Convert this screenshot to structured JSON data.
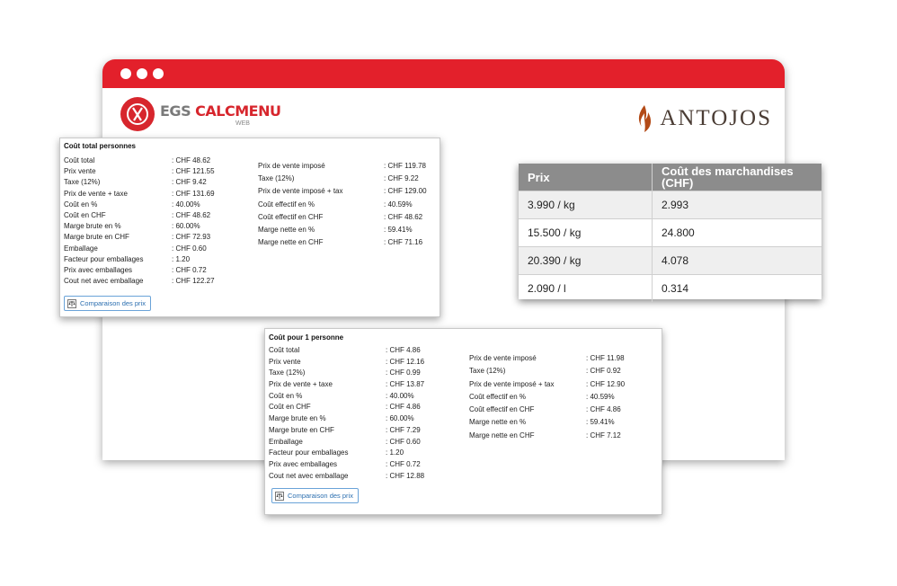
{
  "brands": {
    "left_logo": {
      "part1": "EGS",
      "part2": "CALCMENU",
      "sub": "WEB"
    },
    "right_logo": "ANTOJOS"
  },
  "colors": {
    "browser_bar": "#e3202b",
    "logo_red": "#d7262d",
    "table_header": "#8c8c8c",
    "button_blue": "#2c6fb0"
  },
  "total_panel": {
    "title": "Coût total personnes",
    "left": [
      {
        "label": "Coût total",
        "value": ": CHF 48.62"
      },
      {
        "label": "Prix vente",
        "value": ": CHF 121.55"
      },
      {
        "label": "Taxe (12%)",
        "value": ": CHF 9.42"
      },
      {
        "label": "Prix de vente + taxe",
        "value": ": CHF 131.69"
      },
      {
        "label": "Coût en %",
        "value": ": 40.00%"
      },
      {
        "label": "Coût en CHF",
        "value": ": CHF 48.62"
      },
      {
        "label": "Marge brute en %",
        "value": ": 60.00%"
      },
      {
        "label": "Marge brute en CHF",
        "value": ": CHF 72.93"
      },
      {
        "label": "Emballage",
        "value": ": CHF 0.60"
      },
      {
        "label": "Facteur pour emballages",
        "value": ": 1.20"
      },
      {
        "label": "Prix avec emballages",
        "value": ": CHF 0.72"
      },
      {
        "label": "Cout net avec emballage",
        "value": ": CHF 122.27"
      }
    ],
    "right": [
      {
        "label": "Prix de vente imposé",
        "value": ": CHF 119.78"
      },
      {
        "label": "Taxe (12%)",
        "value": ": CHF 9.22"
      },
      {
        "label": "Prix de vente imposé + tax",
        "value": ": CHF 129.00"
      },
      {
        "label": "Coût effectif en %",
        "value": ": 40.59%"
      },
      {
        "label": "Coût effectif en CHF",
        "value": ": CHF 48.62"
      },
      {
        "label": "Marge nette en %",
        "value": ": 59.41%"
      },
      {
        "label": "Marge nette en CHF",
        "value": ": CHF 71.16"
      }
    ],
    "button": "Comparaison des prix"
  },
  "person_panel": {
    "title": "Coût pour 1 personne",
    "left": [
      {
        "label": "Coût total",
        "value": ": CHF 4.86"
      },
      {
        "label": "Prix vente",
        "value": ": CHF 12.16"
      },
      {
        "label": "Taxe (12%)",
        "value": ": CHF 0.99"
      },
      {
        "label": "Prix de vente + taxe",
        "value": ": CHF 13.87"
      },
      {
        "label": "Coût en %",
        "value": ": 40.00%"
      },
      {
        "label": "Coût en CHF",
        "value": ": CHF 4.86"
      },
      {
        "label": "Marge brute en %",
        "value": ": 60.00%"
      },
      {
        "label": "Marge brute en CHF",
        "value": ": CHF 7.29"
      },
      {
        "label": "Emballage",
        "value": ": CHF 0.60"
      },
      {
        "label": "Facteur pour emballages",
        "value": ": 1.20"
      },
      {
        "label": "Prix avec emballages",
        "value": ": CHF 0.72"
      },
      {
        "label": "Cout net avec emballage",
        "value": ": CHF 12.88"
      }
    ],
    "right": [
      {
        "label": "Prix de vente imposé",
        "value": ": CHF 11.98"
      },
      {
        "label": "Taxe (12%)",
        "value": ": CHF 0.92"
      },
      {
        "label": "Prix de vente imposé + tax",
        "value": ": CHF 12.90"
      },
      {
        "label": "Coût effectif en %",
        "value": ": 40.59%"
      },
      {
        "label": "Coût effectif en CHF",
        "value": ": CHF 4.86"
      },
      {
        "label": "Marge nette en %",
        "value": ": 59.41%"
      },
      {
        "label": "Marge nette en CHF",
        "value": ": CHF 7.12"
      }
    ],
    "button": "Comparaison des prix"
  },
  "price_table": {
    "headers": [
      "Prix",
      "Coût des marchandises (CHF)"
    ],
    "rows": [
      [
        "3.990 / kg",
        "2.993"
      ],
      [
        "15.500 / kg",
        "24.800"
      ],
      [
        "20.390 / kg",
        "4.078"
      ],
      [
        "2.090 / l",
        "0.314"
      ]
    ]
  }
}
